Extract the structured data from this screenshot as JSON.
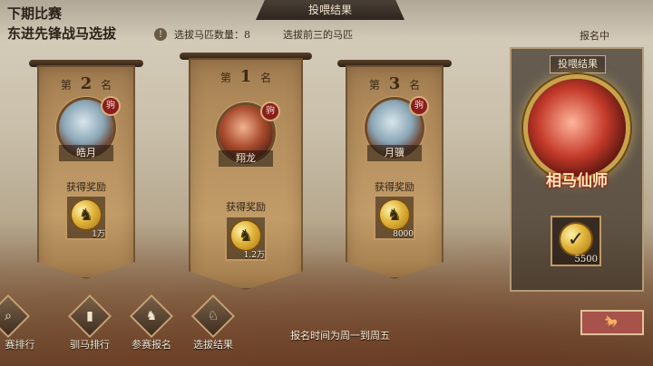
{
  "header": {
    "title_line1": "下期比赛",
    "title_line2": "东进先锋战马选拔",
    "center_tab": "投喂结果",
    "info_icon": "!",
    "info_text1": "选拔马匹数量：8",
    "info_text2": "选拔前三的马匹",
    "status": "报名中"
  },
  "banners": [
    {
      "rank_prefix": "第",
      "rank": "2",
      "rank_suffix": "名",
      "horse_name": "皓月",
      "tag": "驹",
      "reward_label": "获得奖励",
      "reward_amount": "1万"
    },
    {
      "rank_prefix": "第",
      "rank": "1",
      "rank_suffix": "名",
      "horse_name": "翔龙",
      "tag": "驹",
      "reward_label": "获得奖励",
      "reward_amount": "1.2万"
    },
    {
      "rank_prefix": "第",
      "rank": "3",
      "rank_suffix": "名",
      "horse_name": "月骥",
      "tag": "驹",
      "reward_label": "获得奖励",
      "reward_amount": "8000"
    }
  ],
  "panel": {
    "title": "投喂结果",
    "medal_text": "相马仙师",
    "reward_amount": "5500"
  },
  "nav": [
    {
      "label": "赛排行",
      "icon": "magnifier-icon"
    },
    {
      "label": "驯马排行",
      "icon": "bar-chart-icon"
    },
    {
      "label": "参赛报名",
      "icon": "horse-icon"
    },
    {
      "label": "选拔结果",
      "icon": "horse-badge-icon"
    }
  ],
  "bottom_notice": "报名时间为周一到周五",
  "feed_button": "🐎"
}
